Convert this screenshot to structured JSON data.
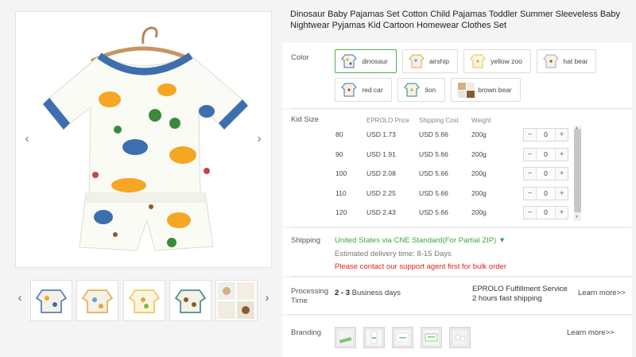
{
  "product": {
    "title": "Dinosaur Baby Pajamas Set Cotton Child Pajamas Toddler Summer Sleeveless Baby Nightwear Pyjamas Kid Cartoon Homewear Clothes Set"
  },
  "gallery": {
    "prev_arrow": "‹",
    "next_arrow": "›",
    "thumb_prev": "‹",
    "thumb_next": "›",
    "thumb_count": 5
  },
  "color": {
    "label": "Color",
    "selected": "dinosaur",
    "options": [
      "dinosaur",
      "airship",
      "yellow zoo",
      "hat bear",
      "red car",
      "lion",
      "brown bear"
    ]
  },
  "sizes": {
    "label": "Kid Size",
    "headers": [
      "EPROLO Price",
      "Shipping Cost",
      "Weight"
    ],
    "rows": [
      {
        "size": "80",
        "price": "USD 1.73",
        "shipping": "USD 5.66",
        "weight": "200g",
        "qty": "0"
      },
      {
        "size": "90",
        "price": "USD 1.91",
        "shipping": "USD 5.66",
        "weight": "200g",
        "qty": "0"
      },
      {
        "size": "100",
        "price": "USD 2.08",
        "shipping": "USD 5.66",
        "weight": "200g",
        "qty": "0"
      },
      {
        "size": "110",
        "price": "USD 2.25",
        "shipping": "USD 5.66",
        "weight": "200g",
        "qty": "0"
      },
      {
        "size": "120",
        "price": "USD 2.43",
        "shipping": "USD 5.66",
        "weight": "200g",
        "qty": "0"
      }
    ],
    "minus": "−",
    "plus": "+"
  },
  "shipping": {
    "label": "Shipping",
    "method": "United States via CNE Standard(For Partial ZIP) ▼",
    "delivery": "Estimated delivery time: 8-15 Days",
    "warning": "Please contact our support agent first for bulk order"
  },
  "processing": {
    "label_line1": "Processing",
    "label_line2": "Time",
    "days_min": "2",
    "days_sep": " - ",
    "days_max": "3",
    "days_suffix": " Business days",
    "service_line1": "EPROLO Fulfillment Service",
    "service_line2": "2 hours fast shipping",
    "learn_more": "Learn more>>"
  },
  "branding": {
    "label": "Branding",
    "learn_more": "Learn more>>",
    "items": 5
  },
  "colors": {
    "accent_green": "#3aa84a",
    "warning_red": "#e02020",
    "selected_border": "#4caf50"
  }
}
